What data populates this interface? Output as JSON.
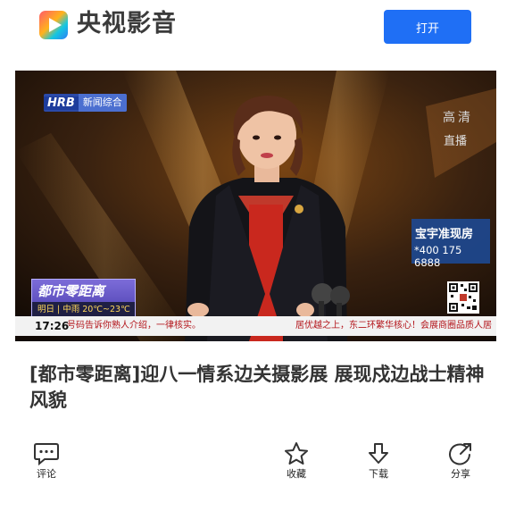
{
  "header": {
    "brand": "央视影音",
    "open_button": "打开"
  },
  "video": {
    "channel_logo": "HRB",
    "channel_name": "新闻综合",
    "quality": "高清",
    "live": "直播",
    "ad_title": "宝宇准现房",
    "ad_phone": "*400 175 6888",
    "program_name": "都市零距离",
    "program_weather": "明日 | 中雨 20℃~23℃",
    "ticker_time": "17:26",
    "ticker_left": "号码告诉你熟人介绍，一律核实。",
    "ticker_right": "居优越之上，东二环繁华核心！会展商圈品质人居"
  },
  "title": "[都市零距离]迎八一情系边关摄影展 展现戍边战士精神风貌",
  "actions": {
    "comment": "评论",
    "collect": "收藏",
    "download": "下载",
    "share": "分享"
  },
  "colors": {
    "accent": "#1f6ff5",
    "logo_gradient": [
      "#ff6a3d",
      "#ffb21c",
      "#14c7e0",
      "#2f7df6"
    ]
  }
}
